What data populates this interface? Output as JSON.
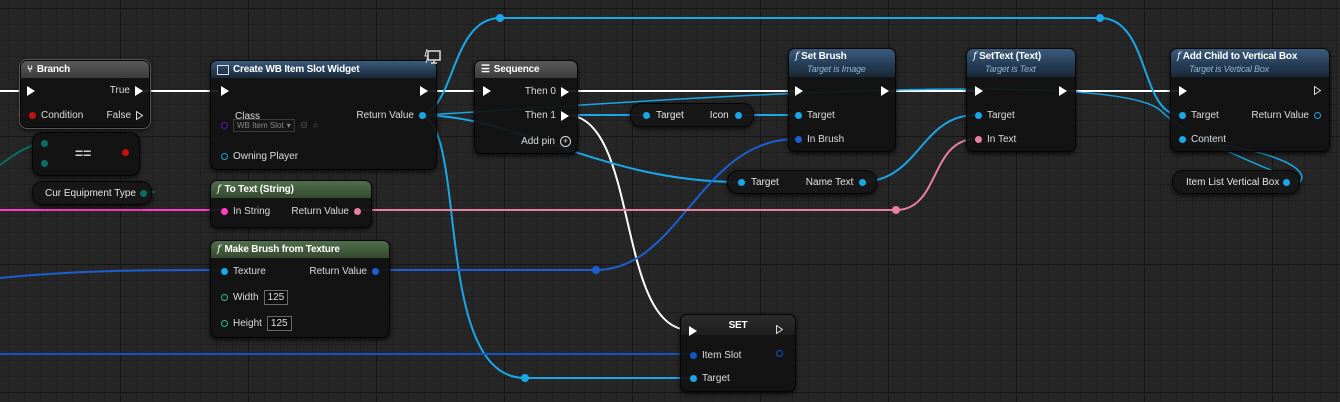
{
  "colors": {
    "exec": "#ffffff",
    "object": "#1aa7e8",
    "object_dark": "#0f56c8",
    "string": "#ff3ec8",
    "text": "#e8819f",
    "byte": "#0a6f62",
    "bool": "#c51010",
    "class": "#5e12b8",
    "struct": "#1b5fd0"
  },
  "nodes": {
    "branch": {
      "title": "Branch",
      "true": "True",
      "condition": "Condition",
      "false": "False"
    },
    "equal": {
      "label": "=="
    },
    "cur_equipment": {
      "label": "Cur Equipment Type"
    },
    "create_widget": {
      "title": "Create WB Item Slot Widget",
      "class": "Class",
      "class_value": "WB Item Slot",
      "return": "Return Value",
      "owning": "Owning Player",
      "icon": "monitor-icon"
    },
    "to_text": {
      "title": "To Text (String)",
      "in": "In String",
      "ret": "Return Value"
    },
    "make_brush": {
      "title": "Make Brush from Texture",
      "texture": "Texture",
      "ret": "Return Value",
      "width": "Width",
      "width_value": "125",
      "height": "Height",
      "height_value": "125"
    },
    "sequence": {
      "title": "Sequence",
      "then0": "Then 0",
      "then1": "Then 1",
      "addpin": "Add pin"
    },
    "get_icon": {
      "target": "Target",
      "out": "Icon"
    },
    "get_name_text": {
      "target": "Target",
      "out": "Name Text"
    },
    "set_brush": {
      "title": "Set Brush",
      "subtitle": "Target is Image",
      "target": "Target",
      "in": "In Brush"
    },
    "set_text": {
      "title": "SetText (Text)",
      "subtitle": "Target is Text",
      "target": "Target",
      "in": "In Text"
    },
    "add_child": {
      "title": "Add Child to Vertical Box",
      "subtitle": "Target is Vertical Box",
      "target": "Target",
      "ret": "Return Value",
      "content": "Content"
    },
    "item_list": {
      "label": "Item List Vertical Box"
    },
    "set_node": {
      "title": "SET",
      "item": "Item Slot",
      "target": "Target"
    }
  }
}
